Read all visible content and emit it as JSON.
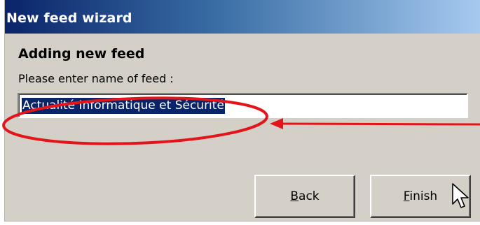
{
  "window": {
    "title": "New feed wizard"
  },
  "page": {
    "heading": "Adding new feed",
    "prompt": "Please enter name of feed :"
  },
  "feed_name_input": {
    "value": "Actualité Informatique et Sécurité",
    "selected": true
  },
  "buttons": {
    "back": {
      "mnemonic": "B",
      "rest": "ack"
    },
    "finish": {
      "mnemonic": "F",
      "rest": "inish"
    }
  },
  "colors": {
    "annotation": "#e3151a",
    "title_bar_start": "#0a246a",
    "title_bar_end": "#a6caf0",
    "selection": "#0a246a",
    "window_face": "#d4d0c8"
  },
  "icons": {
    "cursor": "mouse-pointer-icon",
    "annotation_arrow": "arrow-annotation"
  }
}
